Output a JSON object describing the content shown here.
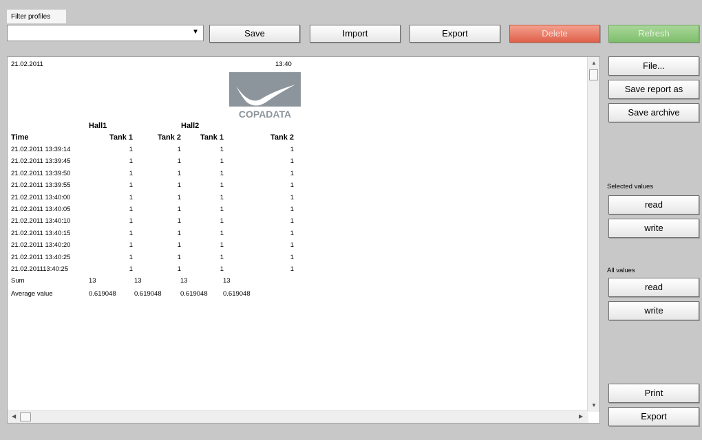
{
  "filter": {
    "tab_label": "Filter profiles",
    "combo_value": ""
  },
  "toolbar": {
    "save": "Save",
    "import": "Import",
    "export": "Export",
    "delete": "Delete",
    "refresh": "Refresh"
  },
  "report": {
    "date": "21.02.2011",
    "time": "13:40",
    "logo_text": "COPADATA",
    "groups": [
      "Hall1",
      "Hall2"
    ],
    "columns": [
      "Time",
      "Tank 1",
      "Tank 2",
      "Tank 1",
      "Tank 2"
    ],
    "rows": [
      {
        "time": "21.02.2011 13:39:14",
        "v": [
          "1",
          "1",
          "1",
          "1"
        ]
      },
      {
        "time": "21.02.2011 13:39:45",
        "v": [
          "1",
          "1",
          "1",
          "1"
        ]
      },
      {
        "time": "21.02.2011 13:39:50",
        "v": [
          "1",
          "1",
          "1",
          "1"
        ]
      },
      {
        "time": "21.02.2011 13:39:55",
        "v": [
          "1",
          "1",
          "1",
          "1"
        ]
      },
      {
        "time": "21.02.2011 13:40:00",
        "v": [
          "1",
          "1",
          "1",
          "1"
        ]
      },
      {
        "time": "21.02.2011 13:40:05",
        "v": [
          "1",
          "1",
          "1",
          "1"
        ]
      },
      {
        "time": "21.02.2011 13:40:10",
        "v": [
          "1",
          "1",
          "1",
          "1"
        ]
      },
      {
        "time": "21.02.2011 13:40:15",
        "v": [
          "1",
          "1",
          "1",
          "1"
        ]
      },
      {
        "time": "21.02.2011 13:40:20",
        "v": [
          "1",
          "1",
          "1",
          "1"
        ]
      },
      {
        "time": "21.02.2011 13:40:25",
        "v": [
          "1",
          "1",
          "1",
          "1"
        ]
      },
      {
        "time": "21.02.201113:40:25",
        "v": [
          "1",
          "1",
          "1",
          "1"
        ]
      }
    ],
    "sum_label": "Sum",
    "sum_values": [
      "13",
      "13",
      "13",
      "13"
    ],
    "avg_label": "Average value",
    "avg_values": [
      "0.619048",
      "0.619048",
      "0.619048",
      "0.619048"
    ]
  },
  "sidebar": {
    "file": "File...",
    "save_report_as": "Save report as",
    "save_archive": "Save archive",
    "selected_values_label": "Selected values",
    "selected_read": "read",
    "selected_write": "write",
    "all_values_label": "All values",
    "all_read": "read",
    "all_write": "write",
    "print": "Print",
    "export": "Export"
  },
  "colors": {
    "background": "#c8c8c8",
    "delete": "#e0604a",
    "refresh": "#7fbf6c"
  }
}
